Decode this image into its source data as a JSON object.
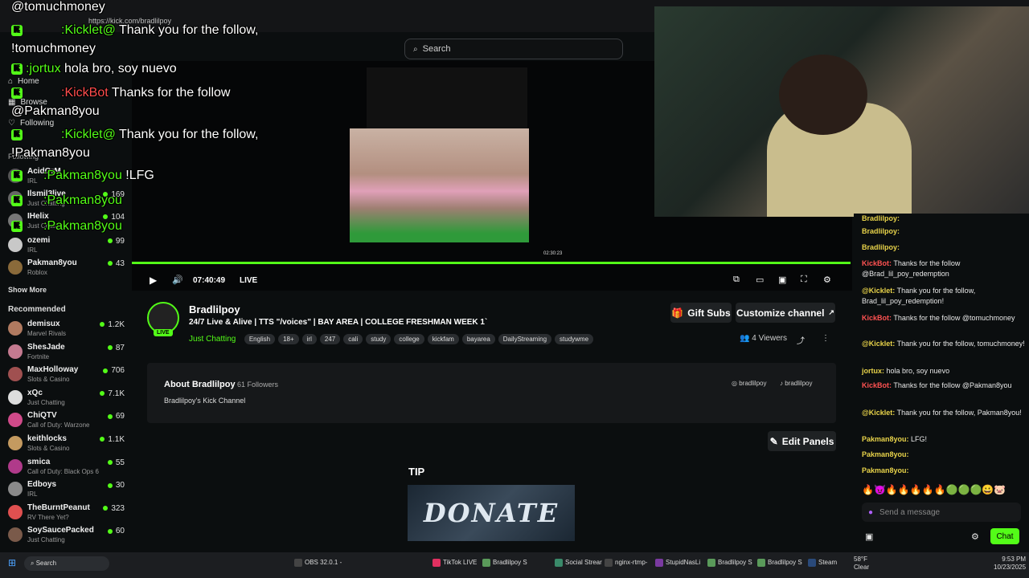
{
  "browser": {
    "url": "https://kick.com/bradlilpoy"
  },
  "search": {
    "placeholder": "Search"
  },
  "nav": {
    "home": "Home",
    "browse": "Browse",
    "following": "Following",
    "following_section": "Following"
  },
  "following": [
    {
      "name": "ozemi",
      "cat": "IRL",
      "viewers": "99",
      "color": "#c8c8c8"
    },
    {
      "name": "Pakman8you",
      "cat": "Roblox",
      "viewers": "43",
      "color": "#8a6a3a"
    }
  ],
  "partial_following": [
    {
      "name": "AcidOrM",
      "cat": "IRL",
      "viewers": ""
    },
    {
      "name": "Ilsmil3live",
      "cat": "Just Chatting",
      "viewers": "169"
    },
    {
      "name": "IHelix",
      "cat": "Just Chatting",
      "viewers": "104"
    }
  ],
  "show_more": "Show More",
  "recommended_title": "Recommended",
  "recommended": [
    {
      "name": "demisux",
      "cat": "Marvel Rivals",
      "viewers": "1.2K",
      "color": "#b07a60"
    },
    {
      "name": "ShesJade",
      "cat": "Fortnite",
      "viewers": "87",
      "color": "#c47a90"
    },
    {
      "name": "MaxHolloway",
      "cat": "Slots & Casino",
      "viewers": "706",
      "color": "#a05050"
    },
    {
      "name": "xQc",
      "cat": "Just Chatting",
      "viewers": "7.1K",
      "color": "#dddddd"
    },
    {
      "name": "ChiQTV",
      "cat": "Call of Duty: Warzone",
      "viewers": "69",
      "color": "#d04a8a"
    },
    {
      "name": "keithlocks",
      "cat": "Slots & Casino",
      "viewers": "1.1K",
      "color": "#c49a60"
    },
    {
      "name": "smica",
      "cat": "Call of Duty: Black Ops 6",
      "viewers": "55",
      "color": "#b03a8a"
    },
    {
      "name": "Edboys",
      "cat": "IRL",
      "viewers": "30",
      "color": "#8a8a8a"
    },
    {
      "name": "TheBurntPeanut",
      "cat": "RV There Yet?",
      "viewers": "323",
      "color": "#e05050"
    },
    {
      "name": "SoySaucePacked",
      "cat": "Just Chatting",
      "viewers": "60",
      "color": "#7a5a4a"
    }
  ],
  "overlay": {
    "line1": "@tomuchmoney",
    "l2_user": ":Kicklet@",
    "l2_text": "Thank you for the follow,",
    "l3": "!tomuchmoney",
    "l4_user": ":jortux",
    "l4_text": "hola bro, soy nuevo",
    "l5_user": ":KickBot",
    "l5_text": "Thanks for the follow",
    "l6": "@Pakman8you",
    "l7_user": ":Kicklet@",
    "l7_text": "Thank you for the follow,",
    "l8": "!Pakman8you",
    "l9_user": ":Pakman8you",
    "l9_text": "!LFG",
    "l10_user": ":Pakman8you",
    "l11_user": ":Pakman8you"
  },
  "player": {
    "time": "07:40:49",
    "live": "LIVE",
    "inner_time": "02:30:23"
  },
  "channel": {
    "name": "Bradlilpoy",
    "title": "24/7 Live & Alive | TTS \"/voices\" | BAY AREA | COLLEGE FRESHMAN WEEK 1`",
    "category": "Just Chatting",
    "live_badge": "LIVE",
    "tags": [
      "English",
      "18+",
      "irl",
      "247",
      "cali",
      "study",
      "college",
      "kickfam",
      "bayarea",
      "DailyStreaming",
      "studywme"
    ],
    "gift_subs": "Gift Subs",
    "customize": "Customize channel",
    "viewers": "4 Viewers"
  },
  "about": {
    "title": "About Bradlilpoy",
    "followers": "61 Followers",
    "description": "Bradlilpoy's Kick Channel",
    "social1": "bradlilpoy",
    "social2": "bradlilpoy"
  },
  "panels": {
    "edit": "Edit Panels",
    "tip": "TIP",
    "donate": "DONATE"
  },
  "chat": {
    "messages": [
      {
        "user": "Bradlilpoy:",
        "text": "",
        "uclass": "yellow"
      },
      {
        "user": "Bradlilpoy:",
        "text": "",
        "uclass": "yellow"
      },
      {
        "user": "Bradlilpoy:",
        "text": "",
        "uclass": "yellow"
      },
      {
        "user": "KickBot:",
        "text": "Thanks for the follow @Brad_lil_poy_redemption",
        "uclass": "red"
      },
      {
        "user": "@Kicklet:",
        "text": "Thank you for the follow, Brad_lil_poy_redemption!",
        "uclass": "yellow"
      },
      {
        "user": "KickBot:",
        "text": "Thanks for the follow @tomuchmoney",
        "uclass": "red"
      },
      {
        "user": "@Kicklet:",
        "text": "Thank you for the follow, tomuchmoney!",
        "uclass": "yellow"
      },
      {
        "user": "jortux:",
        "text": "hola bro, soy nuevo",
        "uclass": "yellow"
      },
      {
        "user": "KickBot:",
        "text": "Thanks for the follow @Pakman8you",
        "uclass": "red"
      },
      {
        "user": "@Kicklet:",
        "text": "Thank you for the follow, Pakman8you!",
        "uclass": "yellow"
      },
      {
        "user": "Pakman8you:",
        "text": "LFG!",
        "uclass": "yellow"
      },
      {
        "user": "Pakman8you:",
        "text": "",
        "uclass": "yellow"
      },
      {
        "user": "Pakman8you:",
        "text": "",
        "uclass": "yellow"
      }
    ],
    "placeholder": "Send a message",
    "chat_button": "Chat"
  },
  "taskbar": {
    "search": "Search",
    "items": [
      "OBS 32.0.1 -",
      "TikTok LIVE",
      "Bradlilpoy S",
      "Social Strear",
      "nginx-rtmp-",
      "StupidNasLi",
      "Bradlilpoy S",
      "Bradlilpoy S",
      "Steam"
    ],
    "weather_temp": "58°F",
    "weather_desc": "Clear",
    "clock_time": "9:53 PM",
    "clock_date": "10/23/2025"
  },
  "colors": {
    "accent": "#53fc18",
    "bg": "#0b0e0f",
    "panel": "#16181a"
  }
}
